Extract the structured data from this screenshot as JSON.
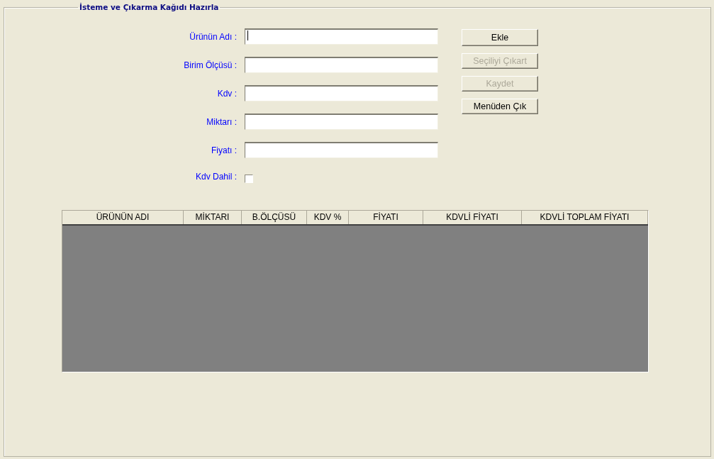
{
  "group_title": "İsteme ve Çıkarma Kağıdı Hazırla",
  "fields": [
    {
      "kind": "text",
      "label": "Ürünün Adı :",
      "focused": true
    },
    {
      "kind": "text",
      "label": "Birim Ölçüsü :",
      "focused": false
    },
    {
      "kind": "text",
      "label": "Kdv :",
      "focused": false
    },
    {
      "kind": "text",
      "label": "Miktarı :",
      "focused": false
    },
    {
      "kind": "text",
      "label": "Fiyatı :",
      "focused": false
    },
    {
      "kind": "checkbox",
      "label": "Kdv Dahil :",
      "checked": false
    }
  ],
  "buttons": [
    {
      "label": "Ekle",
      "disabled": false
    },
    {
      "label": "Seçiliyi Çıkart",
      "disabled": true
    },
    {
      "label": "Kaydet",
      "disabled": true
    },
    {
      "label": "Menüden Çık",
      "disabled": false
    }
  ],
  "table": {
    "columns": [
      "ÜRÜNÜN ADI",
      "MİKTARI",
      "B.ÖLÇÜSÜ",
      "KDV %",
      "FİYATI",
      "KDVLİ FİYATI",
      "KDVLİ TOPLAM FİYATI"
    ]
  }
}
